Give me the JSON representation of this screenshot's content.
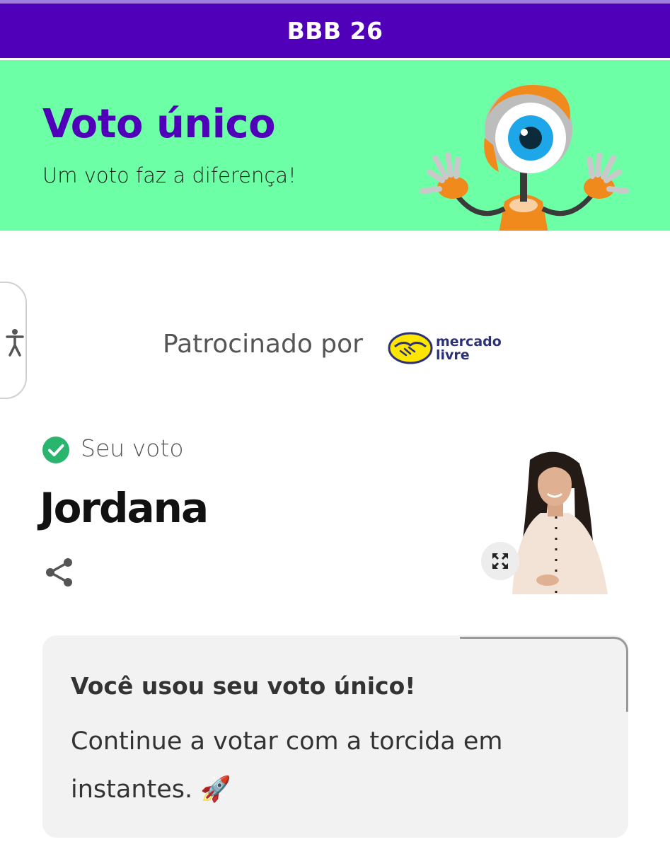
{
  "topbar": {
    "title": "BBB 26",
    "background_color": "#5000b9"
  },
  "hero": {
    "title": "Voto único",
    "subtitle": "Um voto faz a diferença!",
    "background_color": "#6dffa6",
    "title_color": "#5000b9",
    "mascot": "big-brother-eye-robot"
  },
  "accessibility": {
    "icon": "accessibility-person-icon"
  },
  "sponsor": {
    "label": "Patrocinado por",
    "logo_text_line1": "mercado",
    "logo_text_line2": "livre",
    "logo_color": "#ffe600",
    "logo_text_color": "#2d3277"
  },
  "vote": {
    "status_label": "Seu voto",
    "status_icon": "check-circle-icon",
    "status_color": "#2ab56f",
    "candidate_name": "Jordana",
    "share_icon": "share-icon",
    "expand_icon": "expand-icon"
  },
  "card": {
    "title": "Você usou seu voto único!",
    "body": "Continue a votar com a torcida em instantes. 🚀"
  }
}
